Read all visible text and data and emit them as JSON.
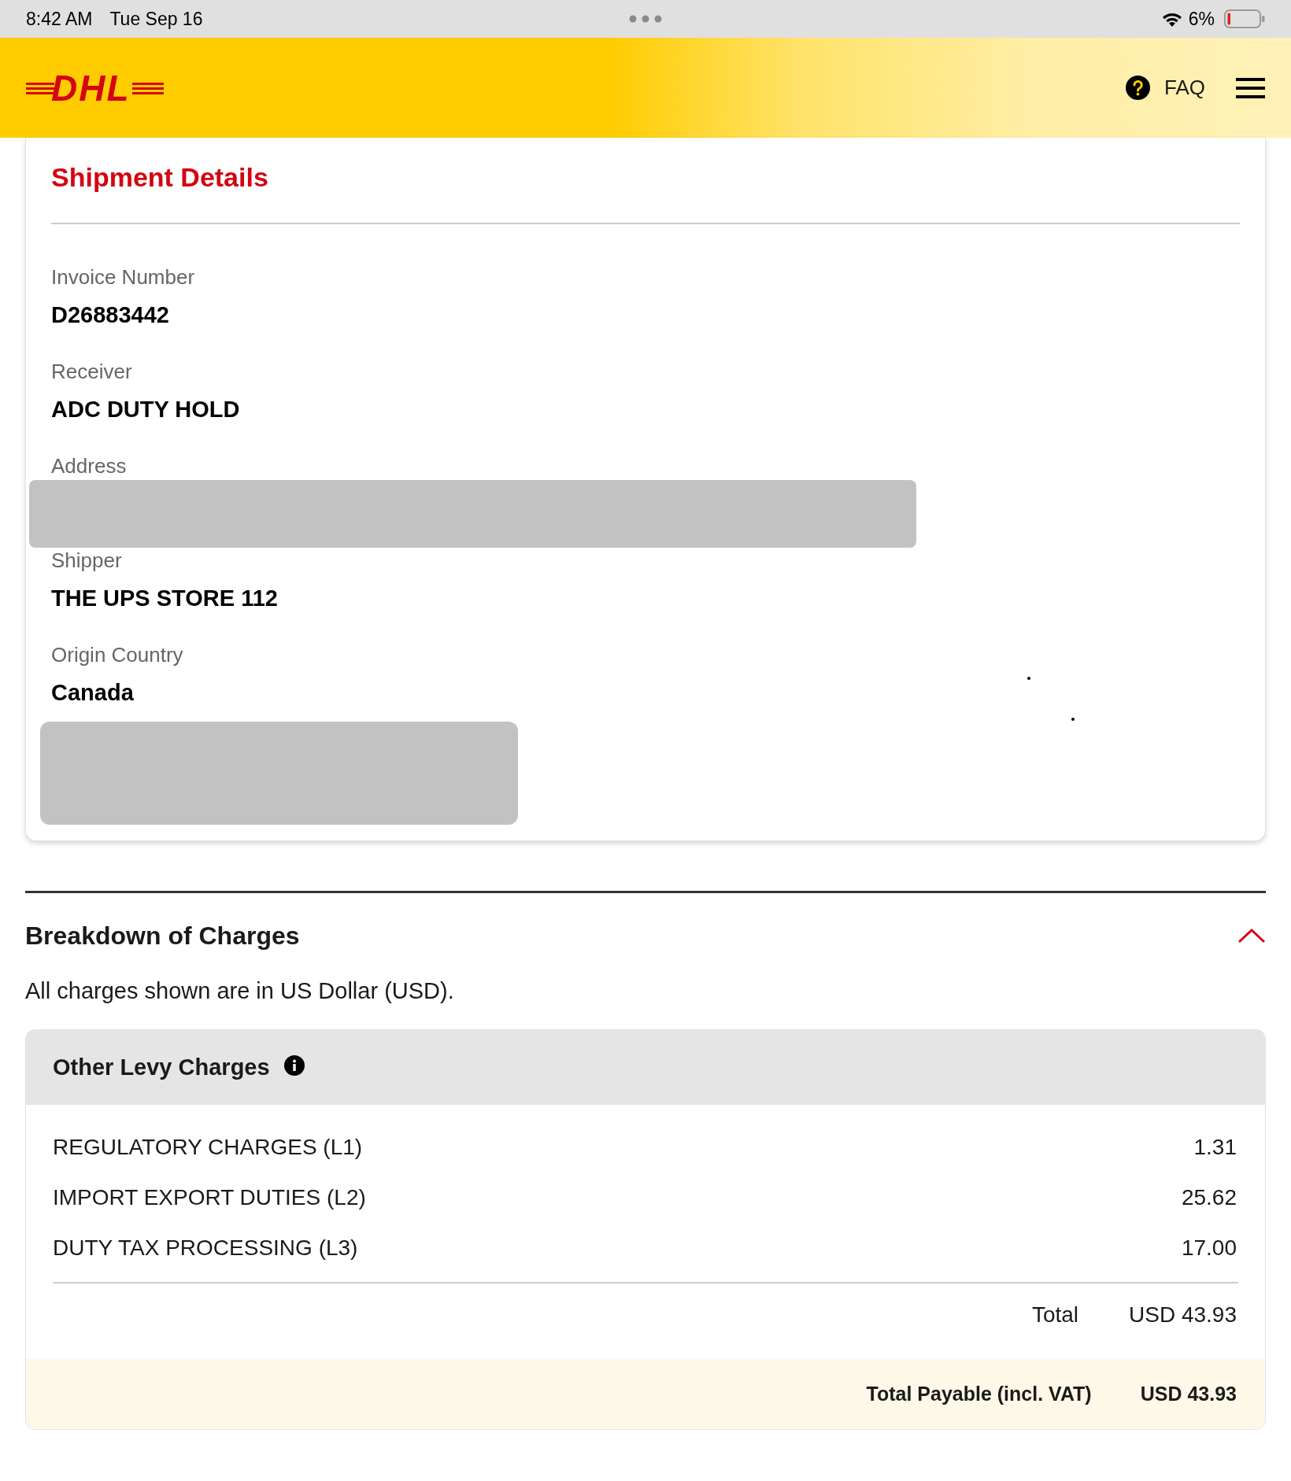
{
  "status_bar": {
    "time": "8:42 AM",
    "date": "Tue Sep 16",
    "battery": "6%"
  },
  "header": {
    "logo": "DHL",
    "faq": "FAQ"
  },
  "shipment_details": {
    "title": "Shipment Details",
    "items": [
      {
        "kind": "field",
        "label": "Invoice Number",
        "value": "D26883442",
        "redacted": false
      },
      {
        "kind": "field",
        "label": "Receiver",
        "value": "ADC DUTY HOLD",
        "redacted": false
      },
      {
        "kind": "field",
        "label": "Address",
        "redacted": true
      },
      {
        "kind": "field",
        "label": "Shipper",
        "value": "THE UPS STORE 112",
        "redacted": false
      },
      {
        "kind": "field",
        "label": "Origin Country",
        "value": "Canada",
        "redacted": false
      },
      {
        "kind": "redaction"
      }
    ]
  },
  "charges": {
    "title": "Breakdown of Charges",
    "expanded": true,
    "note": "All charges shown are in US Dollar (USD).",
    "group": {
      "title": "Other Levy Charges",
      "rows": [
        {
          "label": "REGULATORY CHARGES (L1)",
          "amount": "1.31"
        },
        {
          "label": "IMPORT EXPORT DUTIES (L2)",
          "amount": "25.62"
        },
        {
          "label": "DUTY TAX PROCESSING (L3)",
          "amount": "17.00"
        }
      ],
      "total_label": "Total",
      "total_value": "USD 43.93",
      "payable_label": "Total Payable (incl. VAT)",
      "payable_value": "USD 43.93"
    }
  }
}
